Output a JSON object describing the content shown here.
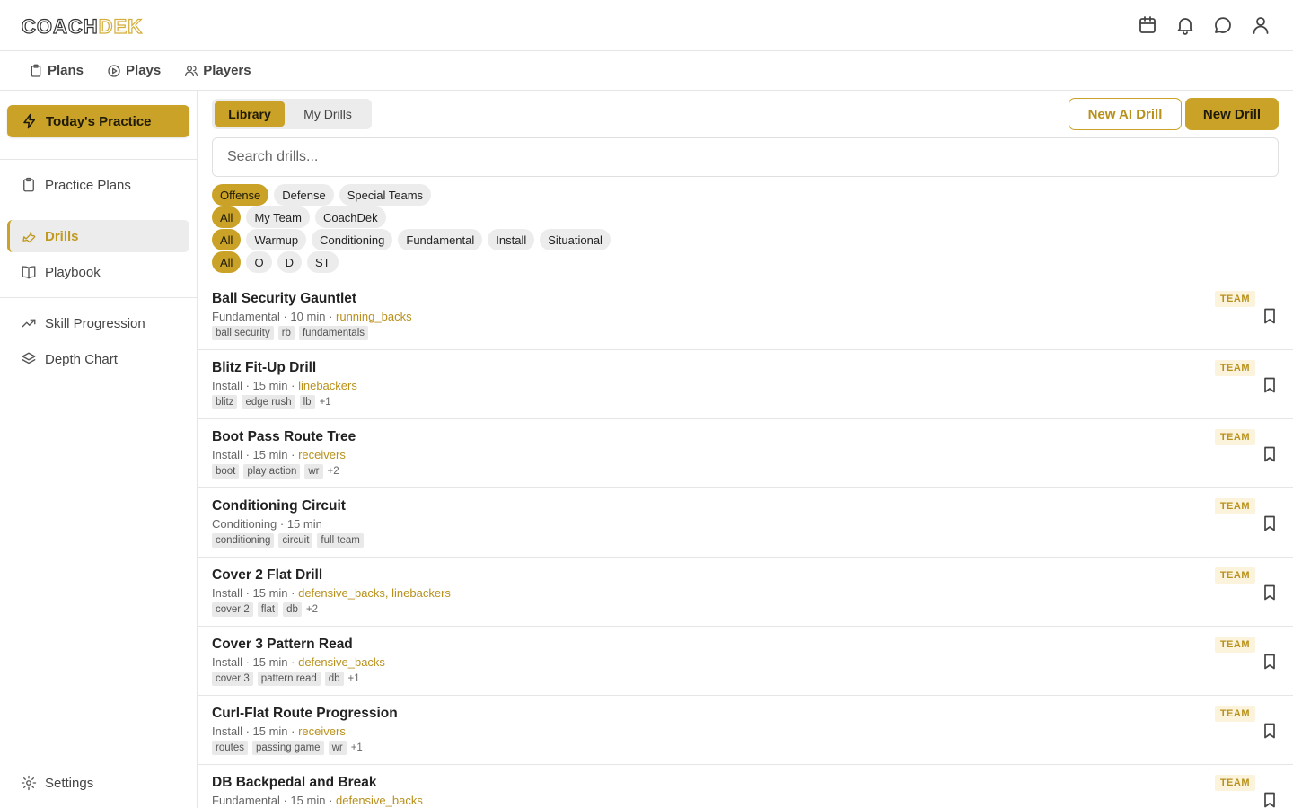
{
  "app": {
    "logo_part1": "COACH",
    "logo_part2": "DEK",
    "header_icons": [
      "calendar-icon",
      "bell-icon",
      "chat-icon",
      "user-icon"
    ]
  },
  "subnav": [
    {
      "label": "Plans",
      "icon": "clipboard-icon"
    },
    {
      "label": "Plays",
      "icon": "play-circle-icon"
    },
    {
      "label": "Players",
      "icon": "users-icon"
    }
  ],
  "sidebar": {
    "today_label": "Today's Practice",
    "items": [
      {
        "label": "Practice Plans",
        "icon": "clipboard-icon"
      },
      {
        "label": "Drills",
        "icon": "wrench-icon",
        "active": true
      },
      {
        "label": "Playbook",
        "icon": "book-icon"
      },
      {
        "label": "Skill Progression",
        "icon": "trend-up-icon"
      },
      {
        "label": "Depth Chart",
        "icon": "layers-icon"
      }
    ],
    "settings_label": "Settings"
  },
  "toolbar": {
    "tabs": [
      "Library",
      "My Drills"
    ],
    "active_tab": "Library",
    "new_ai_label": "New AI Drill",
    "new_drill_label": "New Drill"
  },
  "search": {
    "placeholder": "Search drills...",
    "value": ""
  },
  "filters": {
    "side": {
      "options": [
        "Offense",
        "Defense",
        "Special Teams"
      ],
      "selected": "Offense"
    },
    "source": {
      "options": [
        "All",
        "My Team",
        "CoachDek"
      ],
      "selected": "All"
    },
    "category": {
      "options": [
        "All",
        "Warmup",
        "Conditioning",
        "Fundamental",
        "Install",
        "Situational"
      ],
      "selected": "All"
    },
    "unit": {
      "options": [
        "All",
        "O",
        "D",
        "ST"
      ],
      "selected": "All"
    }
  },
  "colors": {
    "accent": "#c9a227",
    "accent_text": "#b8911c"
  },
  "drills": [
    {
      "title": "Ball Security Gauntlet",
      "meta": "Fundamental · 10 min · ",
      "positions": "running_backs",
      "tags": [
        "ball security",
        "rb",
        "fundamentals"
      ],
      "more": "",
      "badge": "TEAM"
    },
    {
      "title": "Blitz Fit-Up Drill",
      "meta": "Install · 15 min · ",
      "positions": "linebackers",
      "tags": [
        "blitz",
        "edge rush",
        "lb"
      ],
      "more": "+1",
      "badge": "TEAM"
    },
    {
      "title": "Boot Pass Route Tree",
      "meta": "Install · 15 min · ",
      "positions": "receivers",
      "tags": [
        "boot",
        "play action",
        "wr"
      ],
      "more": "+2",
      "badge": "TEAM"
    },
    {
      "title": "Conditioning Circuit",
      "meta": "Conditioning · 15 min",
      "positions": "",
      "tags": [
        "conditioning",
        "circuit",
        "full team"
      ],
      "more": "",
      "badge": "TEAM"
    },
    {
      "title": "Cover 2 Flat Drill",
      "meta": "Install · 15 min · ",
      "positions": "defensive_backs, linebackers",
      "tags": [
        "cover 2",
        "flat",
        "db"
      ],
      "more": "+2",
      "badge": "TEAM"
    },
    {
      "title": "Cover 3 Pattern Read",
      "meta": "Install · 15 min · ",
      "positions": "defensive_backs",
      "tags": [
        "cover 3",
        "pattern read",
        "db"
      ],
      "more": "+1",
      "badge": "TEAM"
    },
    {
      "title": "Curl-Flat Route Progression",
      "meta": "Install · 15 min · ",
      "positions": "receivers",
      "tags": [
        "routes",
        "passing game",
        "wr"
      ],
      "more": "+1",
      "badge": "TEAM"
    },
    {
      "title": "DB Backpedal and Break",
      "meta": "Fundamental · 15 min · ",
      "positions": "defensive_backs",
      "tags": [],
      "more": "",
      "badge": "TEAM"
    }
  ]
}
